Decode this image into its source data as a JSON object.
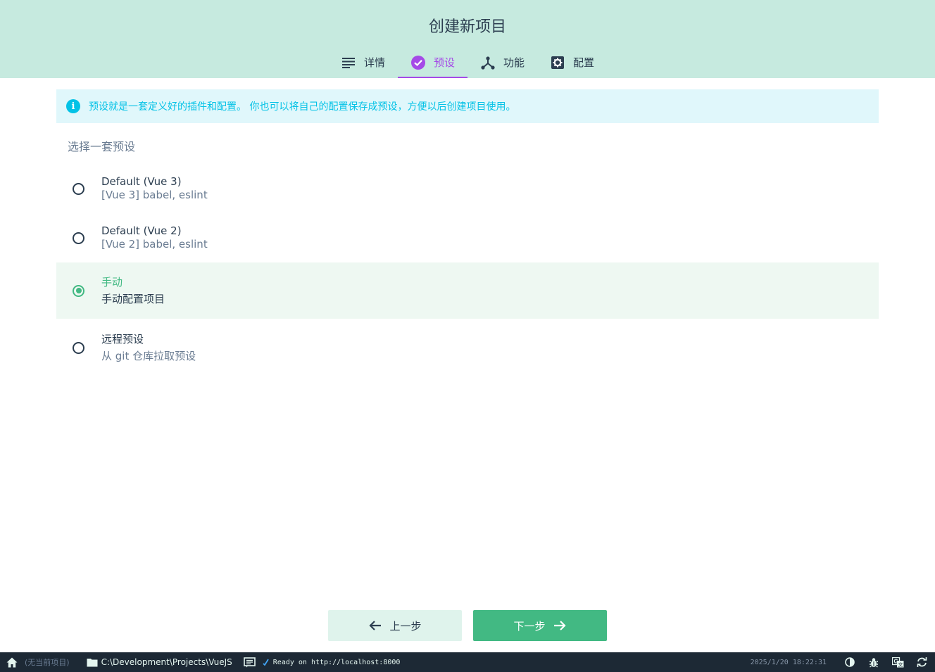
{
  "header": {
    "title": "创建新项目",
    "tabs": [
      {
        "label": "详情",
        "icon": "list-icon",
        "active": false
      },
      {
        "label": "预设",
        "icon": "check-circle-icon",
        "active": true
      },
      {
        "label": "功能",
        "icon": "tree-icon",
        "active": false
      },
      {
        "label": "配置",
        "icon": "gear-icon",
        "active": false
      }
    ]
  },
  "info": {
    "icon": "info-icon",
    "text": "预设就是一套定义好的插件和配置。 你也可以将自己的配置保存成预设，方便以后创建项目使用。"
  },
  "presets": {
    "title": "选择一套预设",
    "options": [
      {
        "name": "Default (Vue 3)",
        "desc": "[Vue 3] babel, eslint",
        "selected": false
      },
      {
        "name": "Default (Vue 2)",
        "desc": "[Vue 2] babel, eslint",
        "selected": false
      },
      {
        "name": "手动",
        "desc": "手动配置项目",
        "selected": true
      },
      {
        "name": "远程预设",
        "desc": "从 git 仓库拉取预设",
        "selected": false
      }
    ]
  },
  "actions": {
    "prev_label": "上一步",
    "next_label": "下一步"
  },
  "statusbar": {
    "project": "(无当前项目)",
    "path": "C:\\Development\\Projects\\VueJS",
    "log": "Ready on http://localhost:8000",
    "datetime": "2025/1/20 18:22:31"
  },
  "colors": {
    "header_bg": "#c6eadf",
    "accent_purple": "#a54ae7",
    "accent_green": "#42b983",
    "info_cyan": "#03c2e6",
    "statusbar_bg": "#1d2935"
  }
}
